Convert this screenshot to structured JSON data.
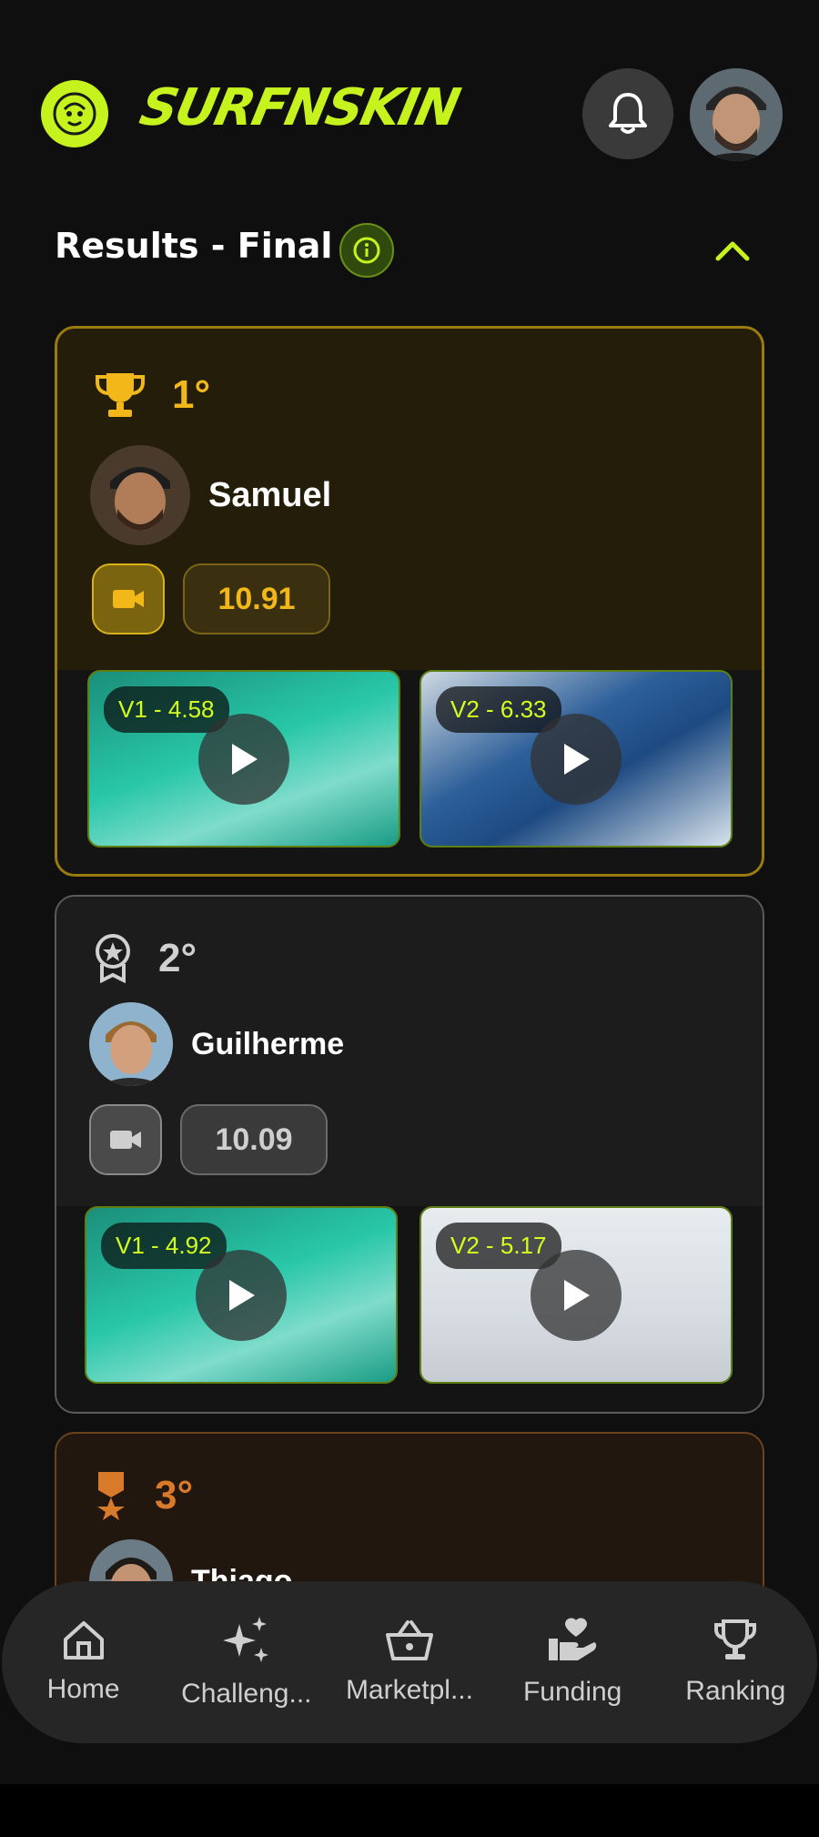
{
  "app": {
    "brand": "SURFNSKIN",
    "accent_color": "#c6f21e"
  },
  "header": {
    "notification_icon": "bell-icon",
    "section_title": "Results - Final",
    "info_icon": "info-icon",
    "collapse_icon": "chevron-up-icon"
  },
  "results": [
    {
      "rank": "1°",
      "rank_icon": "trophy-icon",
      "name": "Samuel",
      "score": "10.91",
      "videos": [
        {
          "label": "V1 - 4.58"
        },
        {
          "label": "V2 - 6.33"
        }
      ]
    },
    {
      "rank": "2°",
      "rank_icon": "medal-star-icon",
      "name": "Guilherme",
      "score": "10.09",
      "videos": [
        {
          "label": "V1 - 4.92"
        },
        {
          "label": "V2 - 5.17"
        }
      ]
    },
    {
      "rank": "3°",
      "rank_icon": "medal-icon",
      "name": "Thiago"
    }
  ],
  "nav": [
    {
      "label": "Home",
      "icon": "home-icon"
    },
    {
      "label": "Challeng...",
      "icon": "sparkles-icon"
    },
    {
      "label": "Marketpl...",
      "icon": "basket-icon"
    },
    {
      "label": "Funding",
      "icon": "hand-heart-icon"
    },
    {
      "label": "Ranking",
      "icon": "trophy-icon"
    }
  ]
}
